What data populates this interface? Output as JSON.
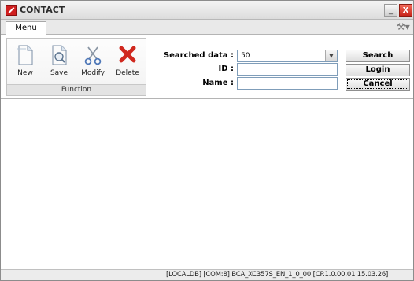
{
  "window": {
    "title": "CONTACT",
    "minimize_label": "_",
    "close_label": "X"
  },
  "ribbon": {
    "tab_label": "Menu",
    "group_label": "Function",
    "buttons": [
      {
        "label": "New",
        "icon": "new-document-icon"
      },
      {
        "label": "Save",
        "icon": "save-document-icon"
      },
      {
        "label": "Modify",
        "icon": "scissors-icon"
      },
      {
        "label": "Delete",
        "icon": "red-x-icon"
      }
    ]
  },
  "form": {
    "searched_label": "Searched data :",
    "searched_value": "50",
    "id_label": "ID :",
    "id_value": "",
    "name_label": "Name :",
    "name_value": "",
    "search_button": "Search",
    "login_button": "Login",
    "cancel_button": "Cancel"
  },
  "status": {
    "text": "[LOCALDB]  [COM:8]  BCA_XC357S_EN_1_0_00 [CP.1.0.00.01 15.03.26]"
  },
  "colors": {
    "close_button": "#c8261b",
    "delete_icon": "#d0281e",
    "field_border": "#7f9db9"
  }
}
